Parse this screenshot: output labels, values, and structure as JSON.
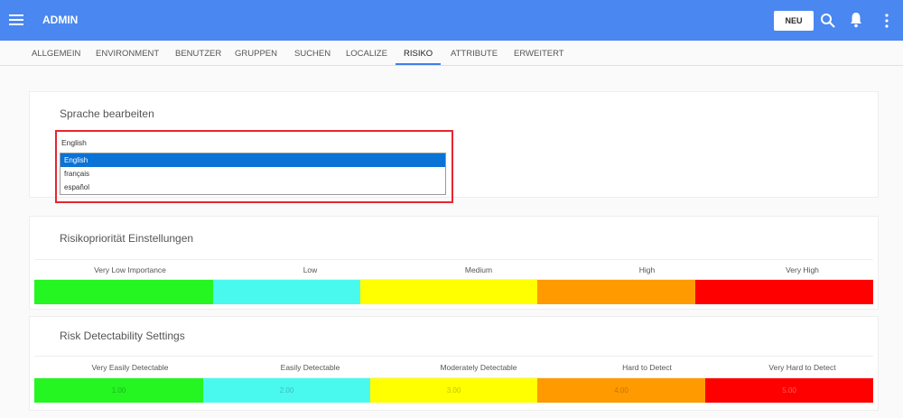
{
  "header": {
    "title": "ADMIN",
    "new_button": "NEU",
    "icons": [
      "menu-icon",
      "search-icon",
      "bell-icon",
      "more-vert-icon"
    ],
    "color": "#4a87f0"
  },
  "tabs": [
    {
      "label": "ALLGEMEIN"
    },
    {
      "label": "ENVIRONMENT"
    },
    {
      "label": "BENUTZER"
    },
    {
      "label": "GRUPPEN"
    },
    {
      "label": "SUCHEN"
    },
    {
      "label": "LOCALIZE"
    },
    {
      "label": "RISIKO",
      "active": true
    },
    {
      "label": "ATTRIBUTE"
    },
    {
      "label": "ERWEITERT"
    }
  ],
  "language": {
    "title": "Sprache bearbeiten",
    "selected": "English",
    "options": [
      "English",
      "français",
      "español"
    ]
  },
  "priority": {
    "title": "Risikopriorität Einstellungen",
    "levels": [
      "Very Low Importance",
      "Low",
      "Medium",
      "High",
      "Very High"
    ],
    "colors": [
      "#25f521",
      "#4af9ee",
      "#ffff00",
      "#ff9a00",
      "#ff0000"
    ]
  },
  "detectability": {
    "title": "Risk Detectability Settings",
    "levels": [
      "Very Easily Detectable",
      "Easily Detectable",
      "Moderately Detectable",
      "Hard to Detect",
      "Very Hard to Detect"
    ],
    "values": [
      "1.00",
      "2.00",
      "3.00",
      "4.00",
      "5.00"
    ],
    "colors": [
      "#25f521",
      "#4af9ee",
      "#ffff00",
      "#ff9a00",
      "#ff0000"
    ]
  }
}
